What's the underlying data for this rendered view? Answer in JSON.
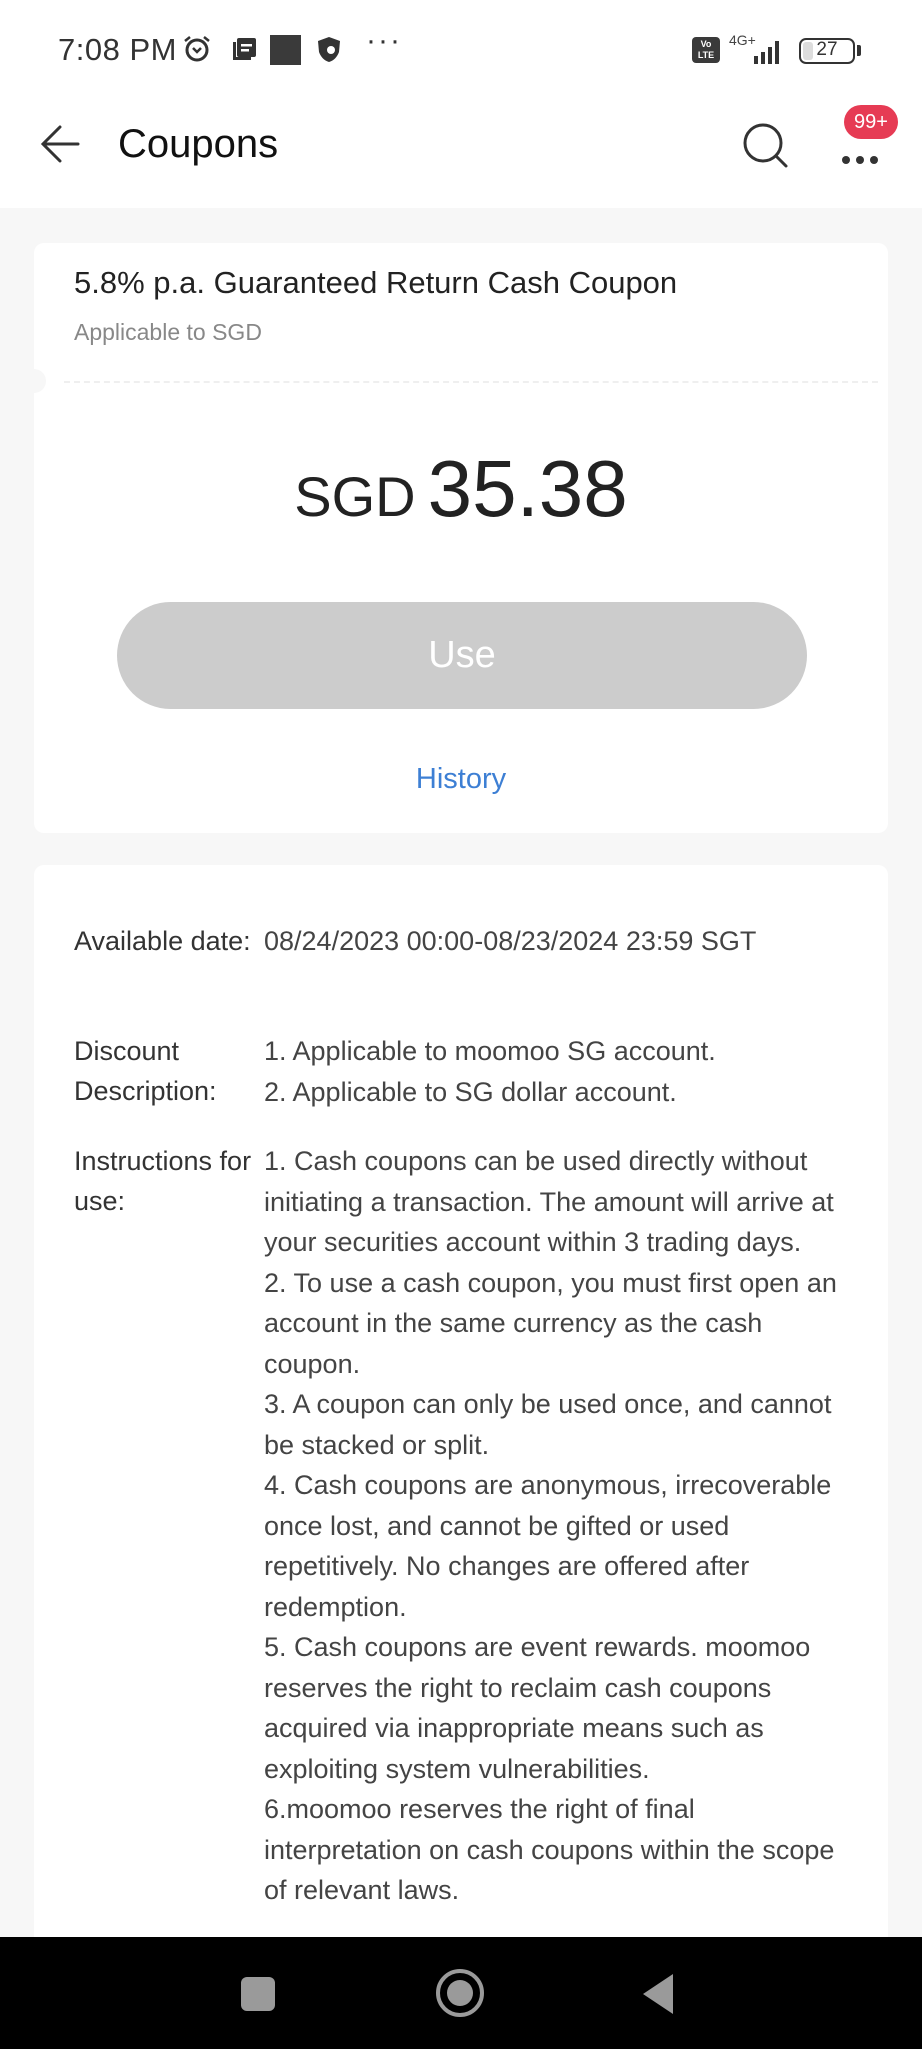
{
  "status_bar": {
    "time": "7:08 PM",
    "icons": [
      "alarm-icon",
      "notes-icon",
      "app-square-icon",
      "shield-icon"
    ],
    "overflow": "···",
    "volte": "Vo LTE",
    "network": "4G+",
    "battery_level": "27"
  },
  "app_bar": {
    "title": "Coupons",
    "badge": "99+"
  },
  "coupon": {
    "title": "5.8% p.a. Guaranteed Return Cash Coupon",
    "subtitle": "Applicable to SGD",
    "currency": "SGD",
    "amount": "35.38",
    "use_label": "Use",
    "history_label": "History"
  },
  "details": {
    "available_date": {
      "label": "Available date:",
      "value": "08/24/2023 00:00-08/23/2024 23:59 SGT"
    },
    "discount": {
      "label": "Discount Description:",
      "lines": [
        "1. Applicable to moomoo SG account.",
        "2. Applicable to SG dollar account."
      ]
    },
    "instructions": {
      "label": "Instructions for use:",
      "lines": [
        "1. Cash coupons can be used directly without initiating a transaction. The amount will arrive at your securities account within 3 trading days.",
        "2. To use a cash coupon, you must first open an account in the same currency as the cash coupon.",
        "3. A coupon can only be used once, and cannot be stacked or split.",
        "4. Cash coupons are anonymous, irrecoverable once lost, and cannot be gifted or used repetitively. No changes are offered after redemption.",
        "5. Cash coupons are event rewards. moomoo reserves the right to reclaim cash coupons acquired via inappropriate means such as exploiting system vulnerabilities.",
        "6.moomoo reserves the right of final interpretation on cash coupons within the scope of relevant laws."
      ]
    }
  },
  "colors": {
    "badge": "#e63b54",
    "link": "#3d7fd4",
    "disabled_button": "#cccccc"
  }
}
